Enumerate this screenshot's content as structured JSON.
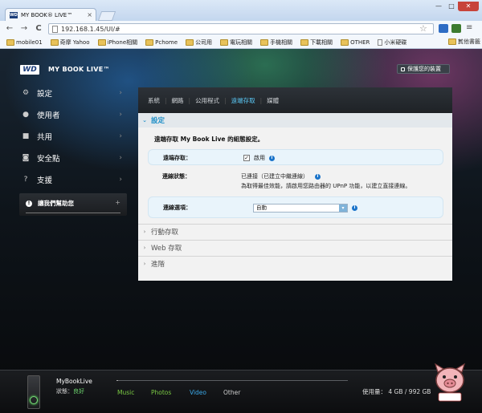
{
  "browser": {
    "tab_title": "MY BOOK® LIVE™",
    "tab_close": "×",
    "url": "192.168.1.45/UI/#",
    "window_buttons": {
      "minimize": "—",
      "maximize": "□",
      "close": "✕"
    },
    "nav": {
      "back": "←",
      "forward": "→",
      "reload": "C"
    },
    "bookmarks": [
      {
        "label": "mobile01",
        "icon": "folder-icon"
      },
      {
        "label": "奇摩 Yahoo",
        "icon": "folder-icon"
      },
      {
        "label": "iPhone相關",
        "icon": "folder-icon"
      },
      {
        "label": "Pchome",
        "icon": "folder-icon"
      },
      {
        "label": "公司用",
        "icon": "folder-icon"
      },
      {
        "label": "電玩相關",
        "icon": "folder-icon"
      },
      {
        "label": "手機相關",
        "icon": "folder-icon"
      },
      {
        "label": "下載相關",
        "icon": "folder-icon"
      },
      {
        "label": "OTHER",
        "icon": "folder-icon"
      },
      {
        "label": "小米硬碟",
        "icon": "page-icon"
      }
    ],
    "bookmarks_more": "»",
    "other_bookmarks": "其他書籤"
  },
  "header": {
    "logo": "WD",
    "product": "MY BOOK LIVE™",
    "protect_button": "保護您的裝置"
  },
  "sidebar": {
    "items": [
      {
        "label": "設定",
        "icon": "gear-icon",
        "glyph": "⚙",
        "active": true
      },
      {
        "label": "使用者",
        "icon": "user-icon",
        "glyph": "●",
        "active": false
      },
      {
        "label": "共用",
        "icon": "folder-icon",
        "glyph": "■",
        "active": false
      },
      {
        "label": "安全點",
        "icon": "safepoint-icon",
        "glyph": "◙",
        "active": false
      },
      {
        "label": "支援",
        "icon": "help-icon",
        "glyph": "?",
        "active": false
      }
    ],
    "chevron": "›",
    "help": {
      "label": "讓我們幫助您",
      "expand": "+",
      "info": "!"
    }
  },
  "panel": {
    "tabs": [
      {
        "label": "系統",
        "active": false
      },
      {
        "label": "網路",
        "active": false
      },
      {
        "label": "公用程式",
        "active": false
      },
      {
        "label": "遠端存取",
        "active": true
      },
      {
        "label": "媒體",
        "active": false
      }
    ],
    "sections": [
      {
        "label": "設定",
        "open": true
      },
      {
        "label": "行動存取",
        "open": false
      },
      {
        "label": "Web 存取",
        "open": false
      },
      {
        "label": "進階",
        "open": false
      }
    ],
    "description": "遠端存取 My Book Live 的組態設定。",
    "remote_access": {
      "label": "遠端存取：",
      "checkbox_checked": true,
      "checkbox_mark": "✓",
      "value": "啟用"
    },
    "connection_status": {
      "label": "連線狀態：",
      "value": "已連接（已建立中繼連線）",
      "note": "為取得最佳效能，請啟用您路由器的 UPnP 功能，以建立直接連線。"
    },
    "connection_option": {
      "label": "連線選項：",
      "value": "自動",
      "dropdown": "▾"
    },
    "info_glyph": "i",
    "arrows": {
      "open": "⌄",
      "closed": "›"
    }
  },
  "footer": {
    "device_name": "MyBookLive",
    "status_label": "狀態：",
    "status_value": "良好",
    "capacity_used_fraction": 0.004,
    "categories": [
      {
        "label": "Music",
        "color": "#7ac943"
      },
      {
        "label": "Photos",
        "color": "#7ac943"
      },
      {
        "label": "Video",
        "color": "#3aa8e8"
      },
      {
        "label": "Other",
        "color": "#cfcfcf"
      }
    ],
    "usage_label": "使用量：",
    "usage_value": "4 GB / 992 GB"
  }
}
